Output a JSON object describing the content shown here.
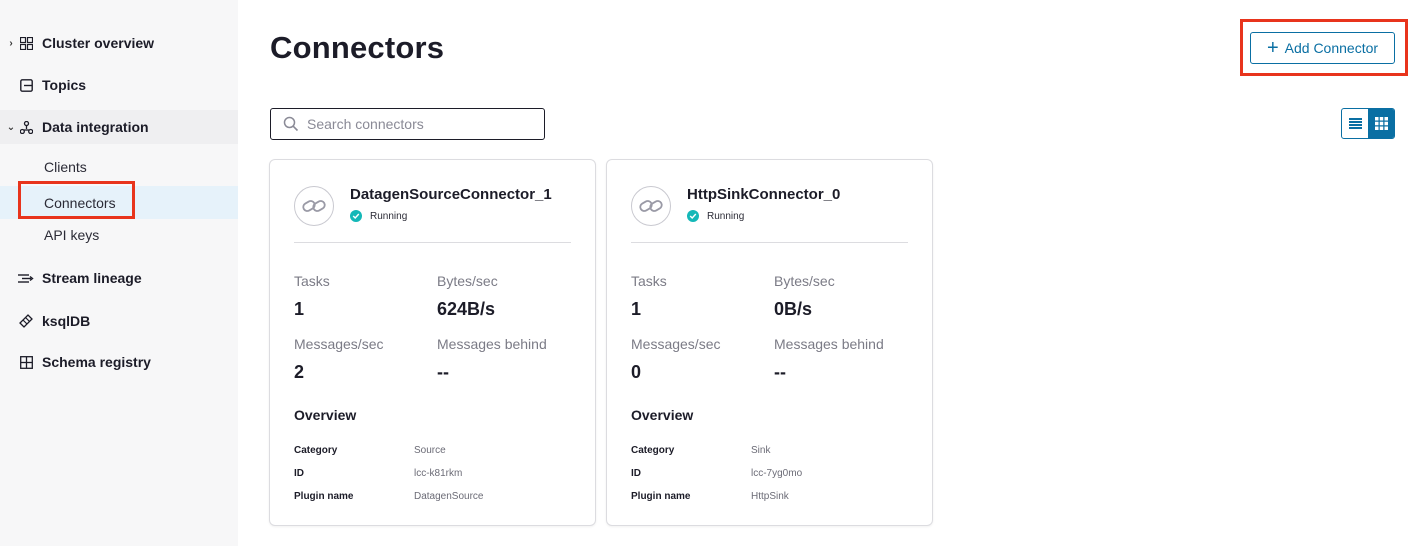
{
  "sidebar": {
    "items": [
      {
        "label": "Cluster overview",
        "icon": "grid-icon",
        "chevron": "›"
      },
      {
        "label": "Topics",
        "icon": "topics-icon"
      },
      {
        "label": "Data integration",
        "icon": "data-integration-icon",
        "chevron": "⌄"
      },
      {
        "label": "Stream lineage",
        "icon": "stream-lineage-icon"
      },
      {
        "label": "ksqlDB",
        "icon": "ksqldb-icon"
      },
      {
        "label": "Schema registry",
        "icon": "schema-registry-icon"
      }
    ],
    "subitems": [
      {
        "label": "Clients"
      },
      {
        "label": "Connectors"
      },
      {
        "label": "API keys"
      }
    ]
  },
  "main": {
    "title": "Connectors",
    "add_button": {
      "label": "Add Connector"
    },
    "search": {
      "placeholder": "Search connectors",
      "value": ""
    },
    "view_toggle": {
      "options": [
        "list-view-icon",
        "grid-view-icon"
      ],
      "selected": "grid"
    }
  },
  "connectors": [
    {
      "name": "DatagenSourceConnector_1",
      "status": "Running",
      "metrics": {
        "tasks_label": "Tasks",
        "tasks": "1",
        "bytes_label": "Bytes/sec",
        "bytes": "624B/s",
        "messages_label": "Messages/sec",
        "messages": "2",
        "behind_label": "Messages behind",
        "behind": "--"
      },
      "overview": {
        "heading": "Overview",
        "category_label": "Category",
        "category": "Source",
        "id_label": "ID",
        "id": "lcc-k81rkm",
        "plugin_label": "Plugin name",
        "plugin": "DatagenSource"
      }
    },
    {
      "name": "HttpSinkConnector_0",
      "status": "Running",
      "metrics": {
        "tasks_label": "Tasks",
        "tasks": "1",
        "bytes_label": "Bytes/sec",
        "bytes": "0B/s",
        "messages_label": "Messages/sec",
        "messages": "0",
        "behind_label": "Messages behind",
        "behind": "--"
      },
      "overview": {
        "heading": "Overview",
        "category_label": "Category",
        "category": "Sink",
        "id_label": "ID",
        "id": "lcc-7yg0mo",
        "plugin_label": "Plugin name",
        "plugin": "HttpSink"
      }
    }
  ],
  "colors": {
    "accent": "#0a6fa3",
    "status_running": "#14b8b8",
    "highlight": "#e8341c"
  }
}
